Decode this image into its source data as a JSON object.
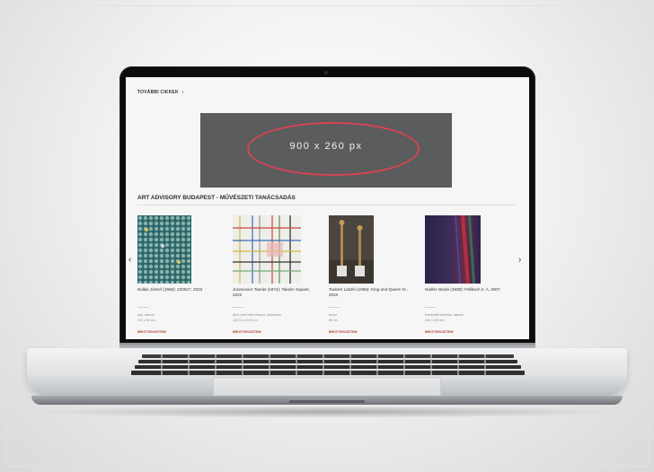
{
  "screen": {
    "more_articles": "TOVÁBBI CIKKEK",
    "more_chevron": "›",
    "banner_text": "900 x 260 px",
    "section_title": "ART ADVISORY BUDAPEST - MŰVÉSZETI TANÁCSADÁS",
    "nav_prev": "‹",
    "nav_next": "›",
    "artworks": [
      {
        "title": "Bullás József (1958): 220627, 2022",
        "medium": "olaj, vászon",
        "size": "120 x 90 cm",
        "button": "MEGTEKINTEM"
      },
      {
        "title": "Jovanovics Tamás (1974): Taksim Square, 2022",
        "medium": "akril, print hőre vászon, dekoráció",
        "size": "102,5 x 102,5 cm",
        "button": "MEGTEKINTEM"
      },
      {
        "title": "Taubert László (1966): King and Queen IV., 2024",
        "medium": "bronz",
        "size": "53 cm",
        "button": "MEGTEKINTEM"
      },
      {
        "title": "Nádler István (1938): Fellbach II. A, 2007",
        "medium": "kombinált technika, vászon",
        "size": "140 x 110 cm",
        "button": "MEGTEKINTEM"
      }
    ]
  },
  "colors": {
    "accent": "#b0392d",
    "oval": "#d64552",
    "banner": "#5b5c5d"
  }
}
